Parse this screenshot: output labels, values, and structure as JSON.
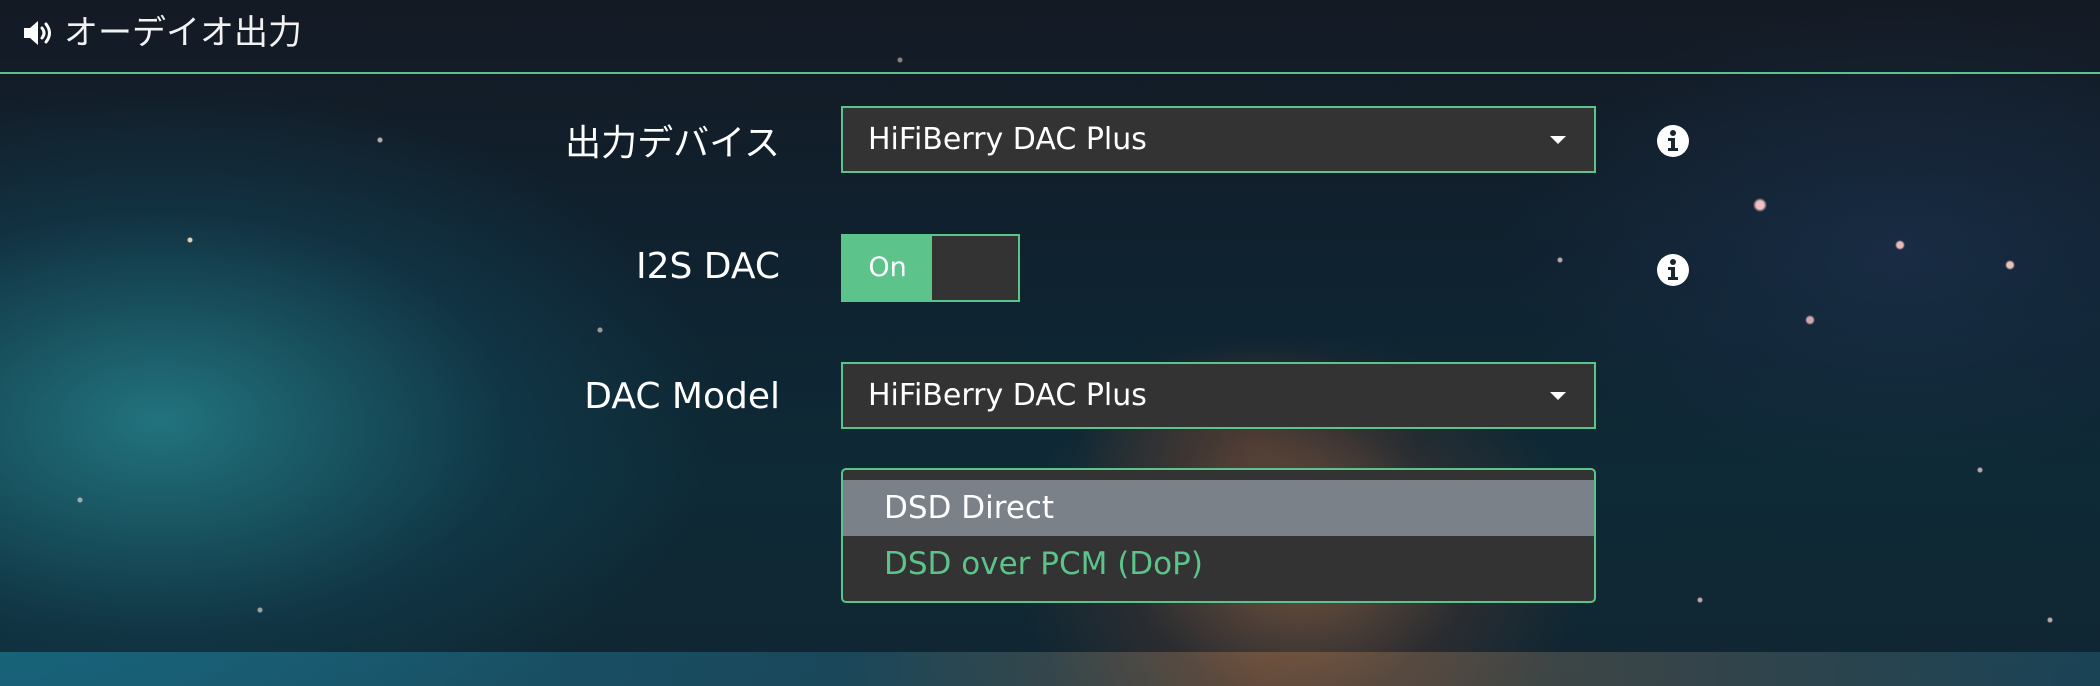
{
  "header": {
    "icon": "speaker-volume-icon",
    "title": "オーデイオ出力"
  },
  "output_device": {
    "label": "出力デバイス",
    "value": "HiFiBerry DAC Plus",
    "info_icon": "info-circle-icon"
  },
  "i2s_dac": {
    "label": "I2S DAC",
    "toggle_label": "On",
    "state": "on",
    "info_icon": "info-circle-icon"
  },
  "dac_model": {
    "label": "DAC Model",
    "value": "HiFiBerry DAC Plus"
  },
  "dsd_dropdown": {
    "options": [
      "DSD Direct",
      "DSD over PCM (DoP)"
    ],
    "highlighted": "DSD Direct",
    "selected": "DSD over PCM (DoP)"
  },
  "colors": {
    "accent": "#5cc38a",
    "control_bg": "#333333",
    "highlight_bg": "#7a8189"
  }
}
